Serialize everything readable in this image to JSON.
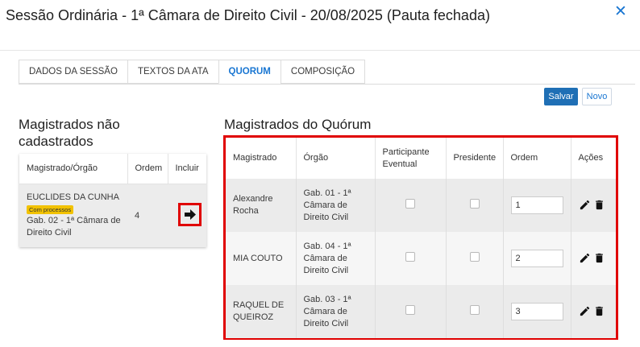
{
  "dialog": {
    "title": "Sessão Ordinária - 1ª Câmara de Direito Civil - 20/08/2025 (Pauta fechada)",
    "close_icon": "close-icon"
  },
  "tabs": [
    {
      "label": "DADOS DA SESSÃO",
      "active": false
    },
    {
      "label": "TEXTOS DA ATA",
      "active": false
    },
    {
      "label": "QUORUM",
      "active": true
    },
    {
      "label": "COMPOSIÇÃO",
      "active": false
    }
  ],
  "toolbar": {
    "save_label": "Salvar",
    "new_label": "Novo"
  },
  "left_panel": {
    "title": "Magistrados não cadastrados",
    "columns": [
      "Magistrado/Órgão",
      "Ordem",
      "Incluir"
    ],
    "rows": [
      {
        "name": "EUCLIDES DA CUNHA",
        "badge": "Com processos",
        "orgao": "Gab. 02 - 1ª Câmara de Direito Civil",
        "ordem": "4",
        "include_icon": "arrow-right-icon"
      }
    ]
  },
  "right_panel": {
    "title": "Magistrados do Quórum",
    "columns": [
      "Magistrado",
      "Órgão",
      "Participante Eventual",
      "Presidente",
      "Ordem",
      "Ações"
    ],
    "rows": [
      {
        "magistrado": "Alexandre Rocha",
        "orgao": "Gab. 01 - 1ª Câmara de Direito Civil",
        "participante_eventual": false,
        "presidente": false,
        "ordem": "1"
      },
      {
        "magistrado": "MIA COUTO",
        "orgao": "Gab. 04 - 1ª Câmara de Direito Civil",
        "participante_eventual": false,
        "presidente": false,
        "ordem": "2"
      },
      {
        "magistrado": "RAQUEL DE QUEIROZ",
        "orgao": "Gab. 03 - 1ª Câmara de Direito Civil",
        "participante_eventual": false,
        "presidente": false,
        "ordem": "3"
      }
    ],
    "action_icons": [
      "pencil-icon",
      "trash-icon"
    ]
  },
  "colors": {
    "accent": "#1976d2",
    "highlight": "#e00000",
    "badge": "#f2c200"
  }
}
